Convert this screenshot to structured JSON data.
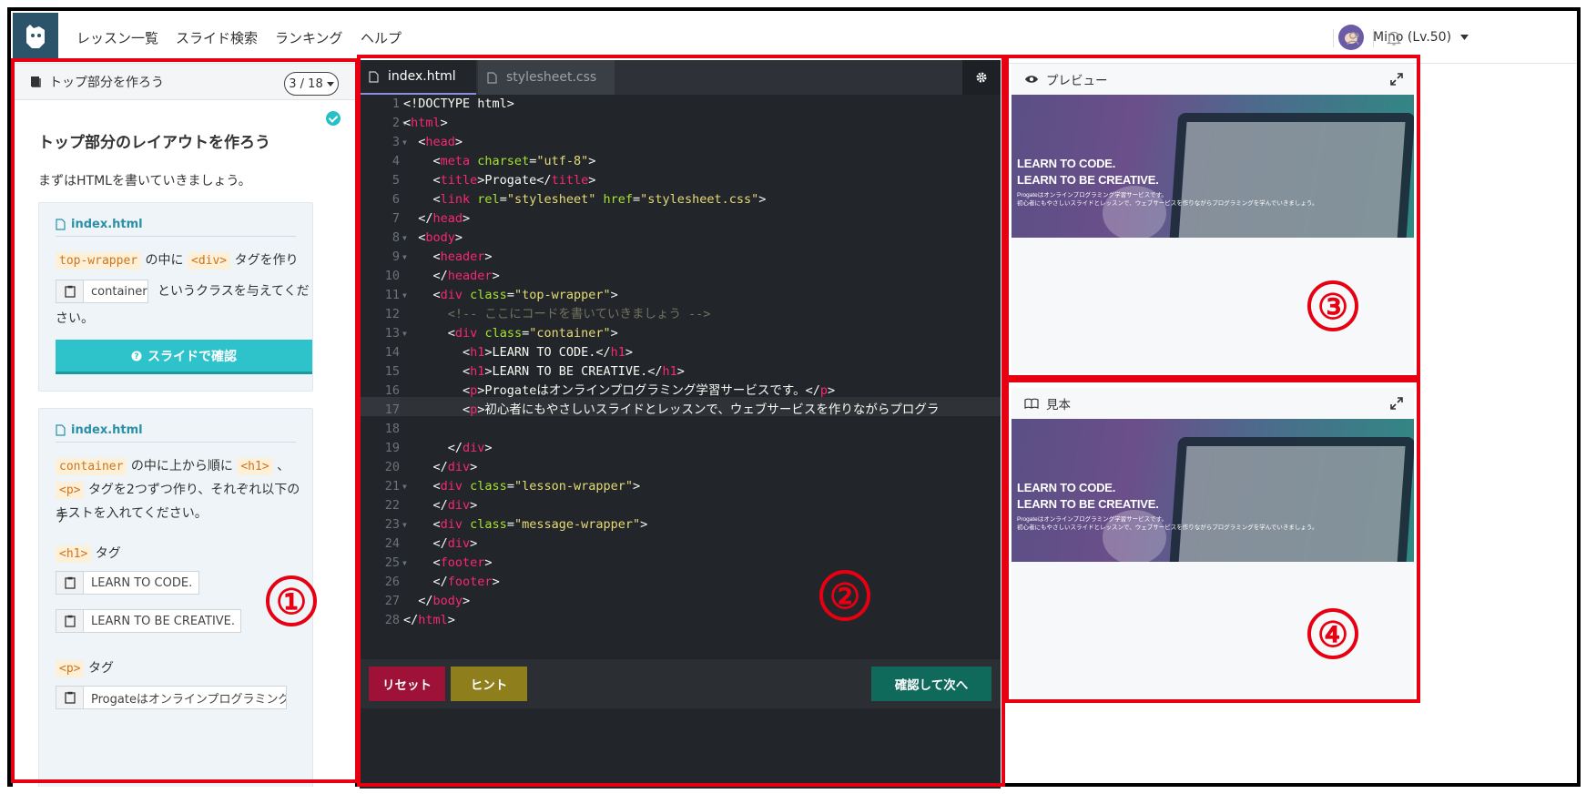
{
  "nav": {
    "links": [
      "レッスン一覧",
      "スライド検索",
      "ランキング",
      "ヘルプ"
    ],
    "user_label": "Mino (Lv.50)"
  },
  "lesson": {
    "header_title": "トップ部分を作ろう",
    "pager": "3 / 18",
    "title": "トップ部分のレイアウトを作ろう",
    "intro": "まずはHTMLを書いていきましょう。",
    "task1": {
      "file": "index.html",
      "code_a": "top-wrapper",
      "text_a": "の中に",
      "code_b": "<div>",
      "text_b": "タグを作り",
      "copy_value": "container",
      "text_c": "というクラスを与えてくだ",
      "text_d": "さい。",
      "button_label": "スライドで確認"
    },
    "task2": {
      "file": "index.html",
      "code_a": "container",
      "text_a": "の中に上から順に",
      "code_b": "<h1>",
      "text_b": "、",
      "code_c": "<p>",
      "text_c": "タグを2つずつ作り、それぞれ以下のテ",
      "text_d": "キストを入れてください。",
      "h1_code": "<h1>",
      "h1_label": "タグ",
      "copy_h1_a": "LEARN TO CODE.",
      "copy_h1_b": "LEARN TO BE CREATIVE.",
      "p_code": "<p>",
      "p_label": "タグ",
      "copy_p_a": "Progateはオンラインプログラミング学"
    }
  },
  "editor": {
    "tabs": [
      "index.html",
      "stylesheet.css"
    ],
    "buttons": {
      "reset": "リセット",
      "hint": "ヒント",
      "next": "確認して次へ"
    }
  },
  "preview": {
    "title": "プレビュー",
    "h1_a": "LEARN TO CODE.",
    "h1_b": "LEARN TO BE CREATIVE.",
    "p_a": "Progateはオンラインプログラミング学習サービスです。",
    "p_b": "初心者にもやさしいスライドとレッスンで、ウェブサービスを作りながらプログラミングを学んでいきましょう。"
  },
  "sample": {
    "title": "見本",
    "h1_a": "LEARN TO CODE.",
    "h1_b": "LEARN TO BE CREATIVE.",
    "p_a": "Progateはオンラインプログラミング学習サービスです。",
    "p_b": "初心者にもやさしいスライドとレッスンで、ウェブサービスを作りながらプログラミングを学んでいきましょう。"
  },
  "annotations": [
    "①",
    "②",
    "③",
    "④"
  ]
}
